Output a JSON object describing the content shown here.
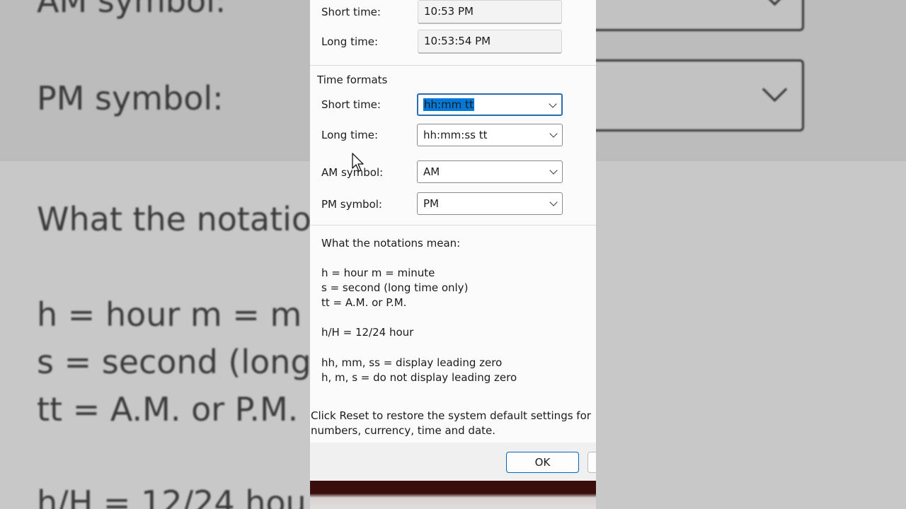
{
  "background": {
    "left_lines": [
      "AM symbol:",
      "PM symbol:",
      "What the notatio",
      "h = hour   m = m",
      "s = second (long",
      "tt = A.M. or P.M.",
      "h/H = 12/24 hou"
    ]
  },
  "dialog": {
    "current": {
      "short_time_label": "Short time:",
      "short_time_value": "10:53 PM",
      "long_time_label": "Long time:",
      "long_time_value": "10:53:54 PM"
    },
    "time_formats": {
      "group_title": "Time formats",
      "short_time_label": "Short time:",
      "short_time_value": "hh:mm tt",
      "long_time_label": "Long time:",
      "long_time_value": "hh:mm:ss tt",
      "am_label": "AM symbol:",
      "am_value": "AM",
      "pm_label": "PM symbol:",
      "pm_value": "PM"
    },
    "notations": {
      "heading": "What the notations mean:",
      "line1": "h = hour   m = minute",
      "line2": "s = second (long time only)",
      "line3": "tt = A.M. or P.M.",
      "line4": "h/H = 12/24 hour",
      "line5": "hh, mm, ss = display leading zero",
      "line6": "h, m, s = do not display leading zero"
    },
    "reset_note_line1": "Click Reset to restore the system default settings for",
    "reset_note_line2": "numbers, currency, time and date.",
    "ok_label": "OK"
  }
}
